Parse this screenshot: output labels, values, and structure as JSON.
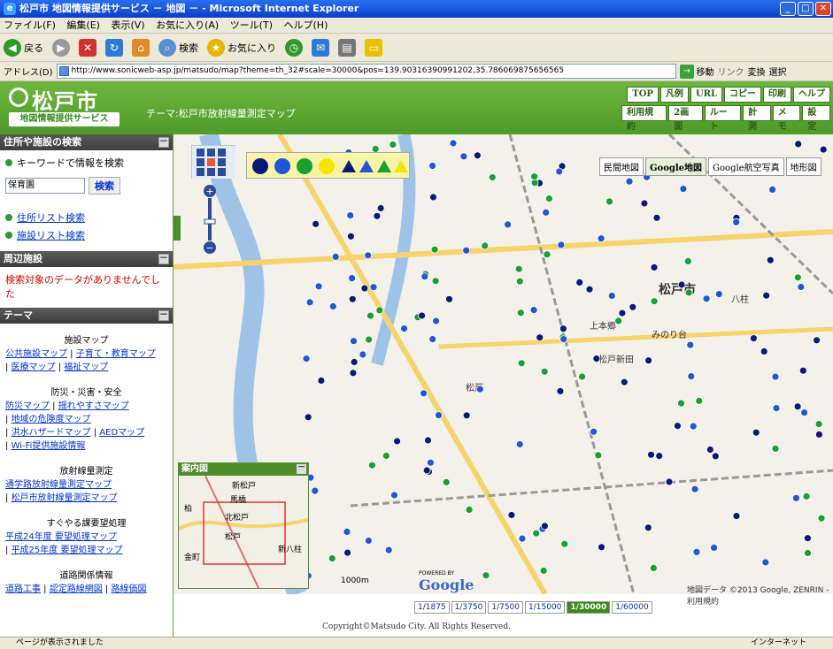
{
  "window": {
    "title": "松戸市  地図情報提供サービス － 地図 －  - Microsoft Internet Explorer",
    "min": "_",
    "max": "□",
    "close": "✕"
  },
  "menu": [
    "ファイル(F)",
    "編集(E)",
    "表示(V)",
    "お気に入り(A)",
    "ツール(T)",
    "ヘルプ(H)"
  ],
  "toolbar": {
    "back": "戻る",
    "search": "検索",
    "favorites": "お気に入り"
  },
  "address": {
    "label": "アドレス(D)",
    "url": "http://www.sonicweb-asp.jp/matsudo/map?theme=th_32#scale=30000&pos=139.90316390991202,35.786069875656565",
    "go": "移動",
    "links": "リンク",
    "henkan": "変換",
    "sentaku": "選択"
  },
  "header": {
    "logo_name": "松戸市",
    "logo_sub": "地図情報提供サービス",
    "theme": "テーマ:松戸市放射線量測定マップ",
    "nav_row1": [
      "TOP",
      "凡例",
      "URL",
      "コピー",
      "印刷",
      "ヘルプ"
    ],
    "nav_row2": [
      "利用規約",
      "2画面",
      "ルート",
      "計測",
      "メモ",
      "設定"
    ]
  },
  "search_section": {
    "title": "住所や施設の検索",
    "keyword_label": "キーワードで情報を検索",
    "keyword_value": "保育園",
    "search_button": "検索",
    "address_link": "住所リスト検索",
    "facility_link": "施設リスト検索"
  },
  "nearby_section": {
    "title": "周辺施設",
    "message": "検索対象のデータがありませんでした"
  },
  "theme_section": {
    "title": "テーマ",
    "groups": [
      {
        "heading": "施設マップ",
        "links": [
          "公共施設マップ",
          "子育て・教育マップ",
          "医療マップ",
          "福祉マップ"
        ]
      },
      {
        "heading": "防災・災害・安全",
        "links": [
          "防災マップ",
          "揺れやすさマップ",
          "地域の危険度マップ",
          "洪水ハザードマップ",
          "AEDマップ",
          "Wi-Fi提供施設情報"
        ]
      },
      {
        "heading": "放射線量測定",
        "links": [
          "通学路放射線量測定マップ",
          "松戸市放射線量測定マップ"
        ]
      },
      {
        "heading": "すぐやる課要望処理",
        "links": [
          "平成24年度 要望処理マップ",
          "平成25年度 要望処理マップ"
        ]
      },
      {
        "heading": "道路関係情報",
        "links": [
          "道路工事",
          "認定路線網図",
          "路線価図"
        ]
      }
    ]
  },
  "map": {
    "type_buttons": [
      "民間地図",
      "Google地図",
      "Google航空写真",
      "地形図"
    ],
    "selected_type": "Google地図",
    "city_label": "松戸市",
    "inset_title": "案内図",
    "inset_labels": [
      "新松戸",
      "馬橋",
      "北松戸",
      "松戸",
      "新八柱",
      "金町",
      "柏"
    ],
    "scale_label": "1000m",
    "google_logo": "Google",
    "powered_by": "POWERED BY",
    "attribution": "地図データ ©2013 Google, ZENRIN - 利用規約",
    "place_labels": [
      "松戸新田",
      "八柱",
      "みのり台",
      "上本郷",
      "松戸",
      "新松戸",
      "北松戸",
      "馬橋"
    ],
    "colors": {
      "navy": "#0a1a7a",
      "blue": "#1f57d6",
      "green": "#18a030",
      "yellow": "#f4e600"
    }
  },
  "scales": [
    "1/1875",
    "1/3750",
    "1/7500",
    "1/15000",
    "1/30000",
    "1/60000"
  ],
  "selected_scale": "1/30000",
  "copyright": "Copyright©Matsudo City. All Rights Reserved.",
  "status": {
    "left": "ページが表示されました",
    "zone": "インターネット"
  }
}
